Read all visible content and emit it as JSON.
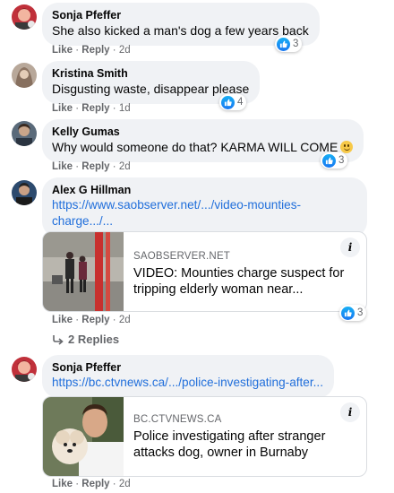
{
  "actions": {
    "like": "Like",
    "reply": "Reply",
    "separator": "·"
  },
  "comments": [
    {
      "author": "Sonja Pfeffer",
      "text": "She also kicked a man's dog a few years back",
      "time": "2d",
      "reactions": "3"
    },
    {
      "author": "Kristina Smith",
      "text": "Disgusting waste, disappear please",
      "time": "1d",
      "reactions": "4"
    },
    {
      "author": "Kelly Gumas",
      "text": "Why would someone do that? KARMA WILL COME",
      "time": "2d",
      "reactions": "3",
      "emoji": "grinning-face"
    },
    {
      "author": "Alex G Hillman",
      "link_line1": "https://www.saobserver.net/.../video-mounties-",
      "link_line2": "charge.../...",
      "time": "2d",
      "reactions": "3",
      "preview": {
        "domain": "SAOBSERVER.NET",
        "title": "VIDEO: Mounties charge suspect for tripping elderly woman near..."
      },
      "replies_label": "2 Replies"
    },
    {
      "author": "Sonja Pfeffer",
      "link": "https://bc.ctvnews.ca/.../police-investigating-after...",
      "time": "2d",
      "preview": {
        "domain": "BC.CTVNEWS.CA",
        "title": "Police investigating after stranger attacks dog, owner in Burnaby"
      }
    }
  ],
  "colors": {
    "link": "#216fdb",
    "bubble": "#f0f2f5",
    "meta": "#65676b",
    "like_blue": "#1877f2"
  }
}
